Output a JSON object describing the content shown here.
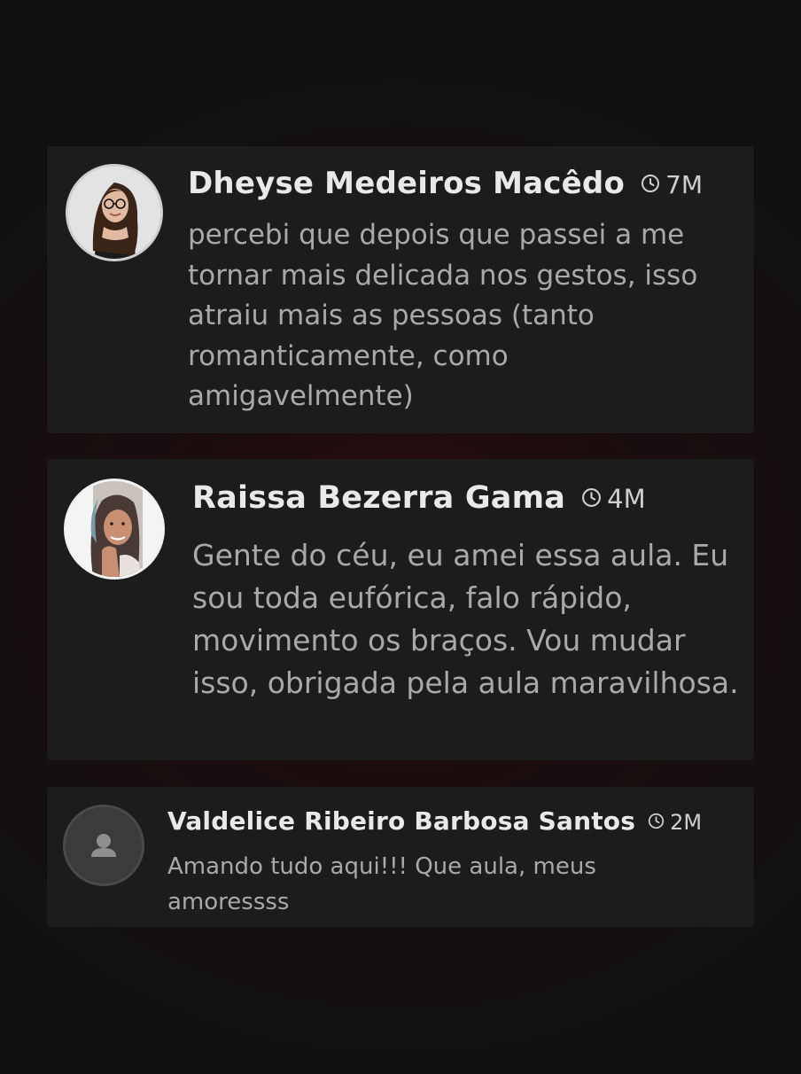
{
  "comments": [
    {
      "author": "Dheyse Medeiros Macêdo",
      "time": "7M",
      "text": "percebi que depois que passei a me tornar mais delicada nos gestos, isso atraiu mais as pessoas (tanto romanticamente, como amigavelmente)",
      "avatar": "profile-photo",
      "time_icon": "clock-icon"
    },
    {
      "author": "Raissa Bezerra Gama",
      "time": "4M",
      "text": "Gente do céu, eu amei essa aula. Eu sou toda eufórica, falo rápido, movimento os braços. Vou mudar isso, obrigada pela aula maravilhosa.",
      "avatar": "profile-photo",
      "time_icon": "clock-icon"
    },
    {
      "author": "Valdelice Ribeiro Barbosa Santos",
      "time": "2M",
      "text": "Amando tudo aqui!!! Que aula, meus amoressss",
      "avatar": "default-user-icon",
      "time_icon": "clock-icon"
    }
  ],
  "colors": {
    "background": "#111010",
    "glow": "#46080a",
    "card": "#1c1c1c",
    "author_text": "#e9e9e9",
    "body_text": "#a9a9a9"
  }
}
